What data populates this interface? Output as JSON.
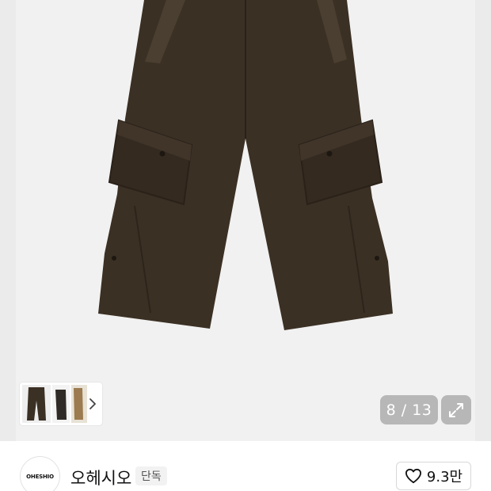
{
  "gallery": {
    "current_index": "8",
    "separator": "/",
    "total": "13",
    "counter_text": "8 / 13"
  },
  "icons": {
    "thumbnail_next": "chevron-right-icon",
    "expand": "expand-icon",
    "like": "heart-icon"
  },
  "brand": {
    "logo_text": "OHESHIO",
    "name": "오헤시오",
    "badge": "단독"
  },
  "like": {
    "count": "9.3만"
  },
  "colors": {
    "product": "#3b3024",
    "gallery_bg": "#f1f1f1",
    "overlay_button": "#b7b7b7"
  }
}
